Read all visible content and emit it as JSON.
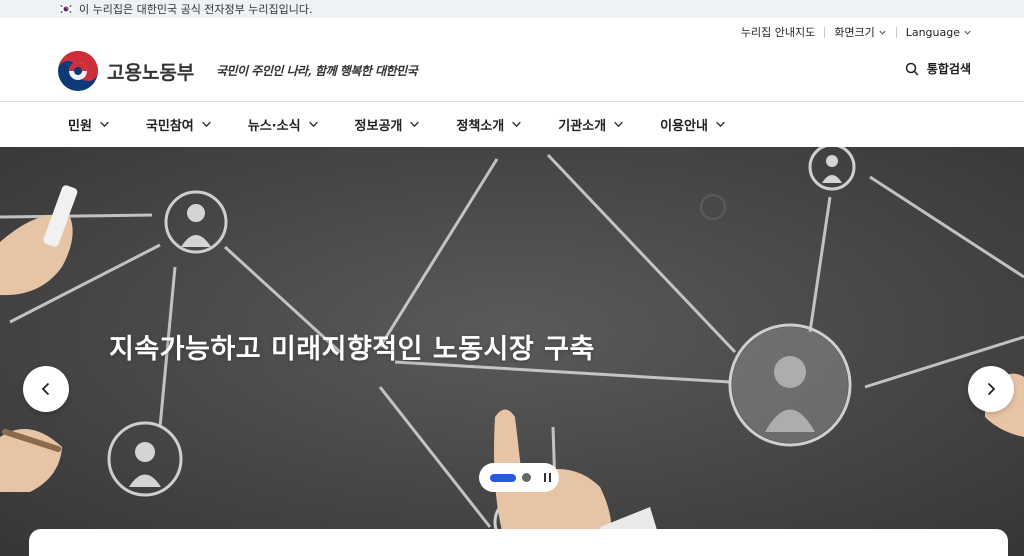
{
  "gov_banner": {
    "text": "이 누리집은 대한민국 공식 전자정부 누리집입니다.",
    "flag_icon": "taegukgi-flag-icon"
  },
  "utility": {
    "sitemap": "누리집 안내지도",
    "font_size": "화면크기",
    "language": "Language"
  },
  "header": {
    "logo_text": "고용노동부",
    "slogan": "국민이 주인인 나라, 함께 행복한 대한민국",
    "search_label": "통합검색"
  },
  "gnb": [
    {
      "label": "민원"
    },
    {
      "label": "국민참여"
    },
    {
      "label": "뉴스·소식"
    },
    {
      "label": "정보공개"
    },
    {
      "label": "정책소개"
    },
    {
      "label": "기관소개"
    },
    {
      "label": "이용안내"
    }
  ],
  "hero": {
    "title": "지속가능하고 미래지향적인 노동시장 구축",
    "slides_total": 2,
    "active_slide": 1
  },
  "colors": {
    "accent": "#2b56e8",
    "banner_bg": "#eef1f5",
    "logo_red": "#cd2e3a",
    "logo_blue": "#0f3a7a"
  }
}
